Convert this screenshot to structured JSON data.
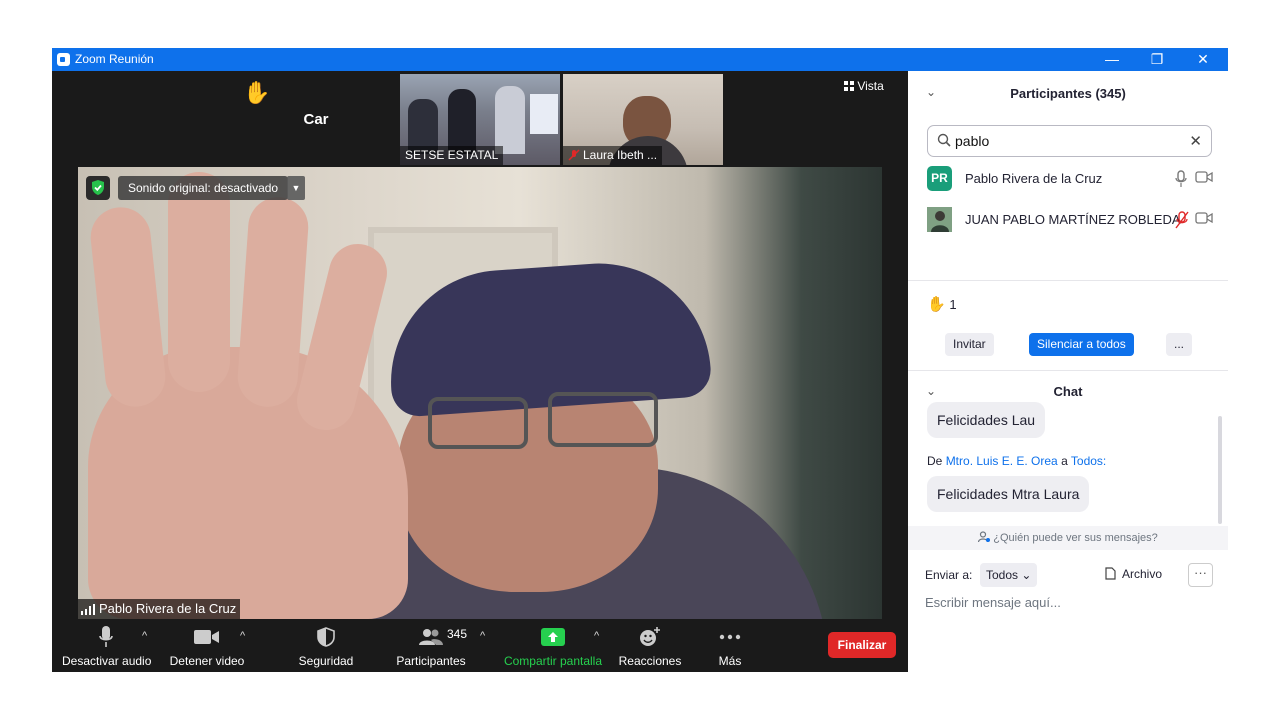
{
  "window": {
    "title": "Zoom Reunión",
    "minimize": "—",
    "restore": "❐",
    "close": "✕"
  },
  "thumbnails": [
    {
      "name": "Car"
    },
    {
      "name": "SETSE ESTATAL"
    },
    {
      "name": "Laura Ibeth ..."
    }
  ],
  "view_label": "Vista",
  "main_video": {
    "speaker": "Pablo Rivera de la Cruz",
    "sound_original": "Sonido original: desactivado"
  },
  "toolbar": {
    "audio": "Desactivar audio",
    "video": "Detener video",
    "security": "Seguridad",
    "participants": "Participantes",
    "participants_count": "345",
    "share": "Compartir pantalla",
    "reactions": "Reacciones",
    "more": "Más",
    "end": "Finalizar"
  },
  "participants_panel": {
    "title": "Participantes (345)",
    "search_value": "pablo",
    "list": [
      {
        "initials": "PR",
        "name": "Pablo Rivera de la Cruz",
        "avatar_color": "#1a9e7a",
        "muted": false
      },
      {
        "initials": "",
        "name": "JUAN PABLO MARTÍNEZ ROBLEDA",
        "avatar_color": "#6b8a70",
        "muted": true
      }
    ],
    "raised_hands": "1",
    "invite": "Invitar",
    "mute_all": "Silenciar a todos",
    "more": "..."
  },
  "chat": {
    "title": "Chat",
    "messages": [
      {
        "text": "Felicidades Lau"
      },
      {
        "from_prefix": "De",
        "sender": "Mtro. Luis E. E. Orea",
        "to_prefix": "a",
        "recipient": "Todos:",
        "text": "Felicidades Mtra Laura"
      }
    ],
    "who_can_see": "¿Quién puede ver sus mensajes?",
    "send_to_label": "Enviar a:",
    "send_to_value": "Todos",
    "file_label": "Archivo",
    "more": "···",
    "placeholder": "Escribir mensaje aquí..."
  },
  "colors": {
    "accent": "#0e71eb",
    "end_red": "#e02828",
    "share_green": "#26d04f"
  }
}
